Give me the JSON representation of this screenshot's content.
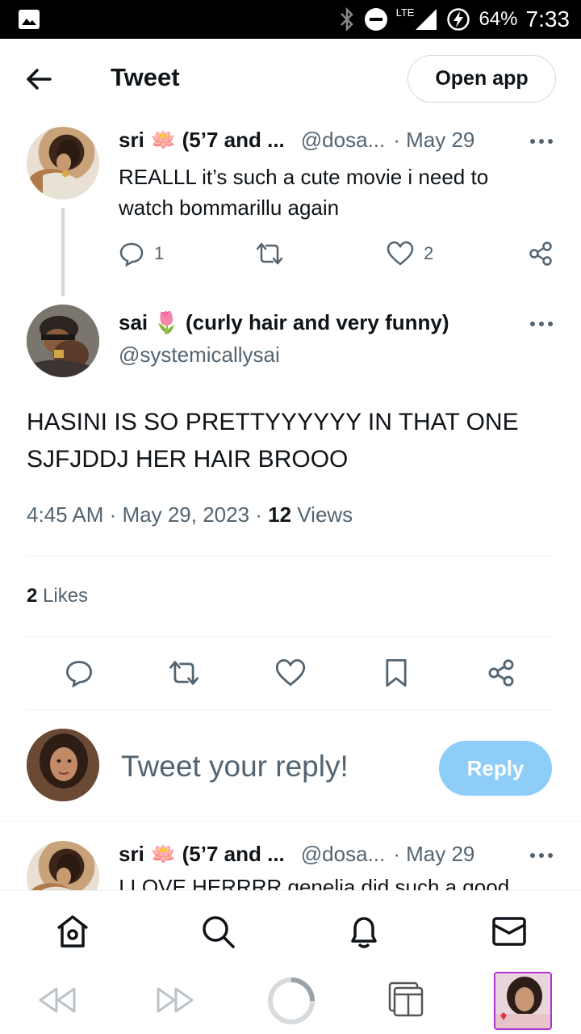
{
  "status_bar": {
    "network": "LTE",
    "battery": "64%",
    "time": "7:33"
  },
  "header": {
    "title": "Tweet",
    "open_app_label": "Open app"
  },
  "parent_tweet": {
    "name": "sri 🪷 (5’7 and ...",
    "handle": "@dosa...",
    "date": "· May 29",
    "text_line1": "REALLL it’s such a cute movie i need to",
    "text_line2": "watch bommarillu again",
    "replies": "1",
    "likes": "2"
  },
  "main_tweet": {
    "name": "sai 🌷 (curly hair and very funny)",
    "handle": "@systemicallysai",
    "text_line1": "HASINI IS SO PRETTYYYYYY IN THAT ONE",
    "text_line2": "SJFJDDJ HER HAIR BROOO",
    "timestamp": "4:45 AM · May 29, 2023 · ",
    "views_count": "12",
    "views_label": " Views",
    "likes_count": "2",
    "likes_label": " Likes"
  },
  "reply_box": {
    "placeholder": "Tweet your reply!",
    "reply_label": "Reply"
  },
  "next_tweet": {
    "name": "sri 🪷 (5’7 and ...",
    "handle": "@dosa...",
    "date": "· May 29",
    "text_partial": "I LOVE HERRRR genelia did such a good"
  },
  "icons": {
    "accent": "#1d9bf0",
    "reply_button_color": "#8ecdf8",
    "nav": [
      "home-icon",
      "search-icon",
      "notifications-icon",
      "messages-icon"
    ],
    "browser": [
      "back-icon",
      "forward-icon",
      "loading-icon",
      "tabs-icon",
      "profile-icon"
    ]
  }
}
